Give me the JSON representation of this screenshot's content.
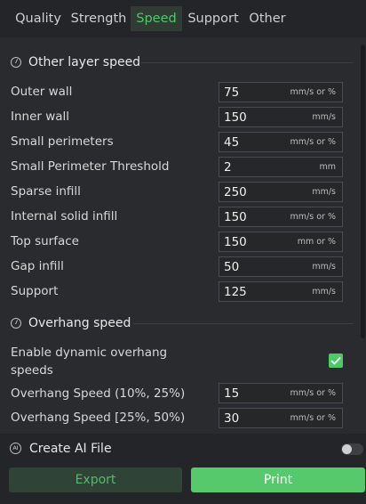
{
  "tabs": [
    {
      "label": "Quality"
    },
    {
      "label": "Strength"
    },
    {
      "label": "Speed"
    },
    {
      "label": "Support"
    },
    {
      "label": "Other"
    }
  ],
  "active_tab": "Speed",
  "sections": {
    "other_layer_speed": {
      "title": "Other layer speed",
      "rows": [
        {
          "label": "Outer wall",
          "value": "75",
          "unit": "mm/s or %"
        },
        {
          "label": "Inner wall",
          "value": "150",
          "unit": "mm/s"
        },
        {
          "label": "Small perimeters",
          "value": "45",
          "unit": "mm/s or %"
        },
        {
          "label": "Small Perimeter Threshold",
          "value": "2",
          "unit": "mm"
        },
        {
          "label": "Sparse infill",
          "value": "250",
          "unit": "mm/s"
        },
        {
          "label": "Internal solid infill",
          "value": "150",
          "unit": "mm/s or %"
        },
        {
          "label": "Top surface",
          "value": "150",
          "unit": "mm or %"
        },
        {
          "label": "Gap infill",
          "value": "50",
          "unit": "mm/s"
        },
        {
          "label": "Support",
          "value": "125",
          "unit": "mm/s"
        }
      ]
    },
    "overhang_speed": {
      "title": "Overhang speed",
      "dynamic_label_line1": "Enable dynamic overhang",
      "dynamic_label_line2": "speeds",
      "dynamic_enabled": true,
      "rows": [
        {
          "label": "Overhang Speed (10%, 25%)",
          "value": "15",
          "unit": "mm/s or %"
        },
        {
          "label": "Overhang Speed [25%, 50%)",
          "value": "30",
          "unit": "mm/s or %"
        }
      ]
    }
  },
  "bottom": {
    "ai_icon_text": "AI",
    "create_ai_label": "Create AI File",
    "create_ai_enabled": false,
    "export_label": "Export",
    "print_label": "Print"
  },
  "colors": {
    "accent": "#57c96d",
    "background": "#242528",
    "panel": "#2a2b2e"
  },
  "icons": [
    "speed-gauge-icon",
    "checkmark-icon",
    "ai-icon"
  ]
}
